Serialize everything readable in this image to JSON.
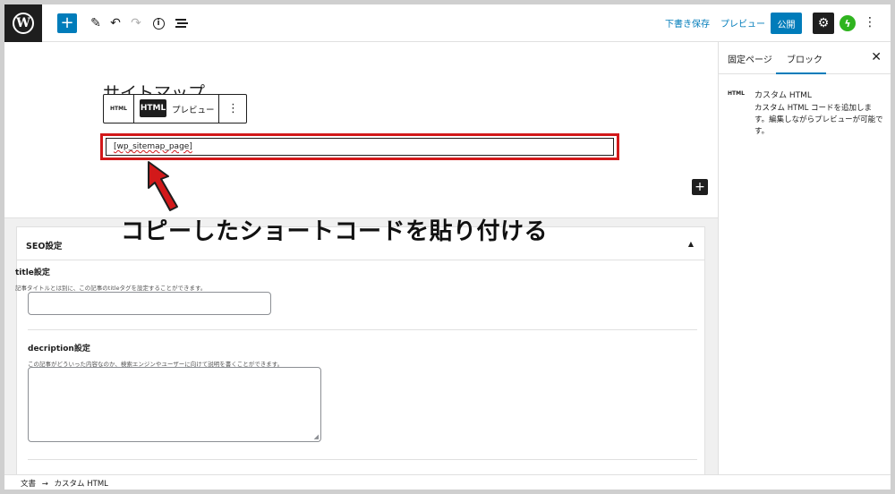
{
  "toolbar": {
    "wp_logo_text": "W",
    "add_label": "+",
    "draft_save": "下書き保存",
    "preview": "プレビュー",
    "publish": "公開"
  },
  "editor": {
    "page_title": "サイトマップ",
    "block_toolbar": {
      "html_icon_label": "HTML",
      "html_button": "HTML",
      "preview_button": "プレビュー"
    },
    "shortcode": "[wp_sitemap_page]",
    "annotation": "コピーしたショートコードを貼り付ける"
  },
  "sidebar": {
    "tabs": [
      "固定ページ",
      "ブロック"
    ],
    "active_tab": "ブロック",
    "block_icon_label": "HTML",
    "block_title": "カスタム HTML",
    "block_description": "カスタム HTML コードを追加します。編集しながらプレビューが可能です。"
  },
  "meta": {
    "title": "SEO設定",
    "title_field": {
      "label": "title設定",
      "description": "記事タイトルとは別に、この記事のtitleタグを設定することができます。",
      "value": ""
    },
    "description_field": {
      "label": "decription設定",
      "description": "この記事がどういった内容なのか、検索エンジンやユーザーに向けて説明を書くことができます。",
      "value": ""
    }
  },
  "footer": {
    "breadcrumb": [
      "文書",
      "カスタム HTML"
    ],
    "separator": "→"
  },
  "colors": {
    "accent": "#007cba",
    "highlight": "#d2191a",
    "dark": "#1e1e1e",
    "jetpack": "#2fb41f"
  },
  "icons": [
    "wordpress-logo-icon",
    "plus-icon",
    "pencil-icon",
    "undo-icon",
    "redo-icon",
    "info-icon",
    "list-view-icon",
    "gear-icon",
    "jetpack-icon",
    "more-vertical-icon",
    "close-icon",
    "html-block-icon",
    "red-arrow-icon",
    "chevron-up-icon"
  ]
}
